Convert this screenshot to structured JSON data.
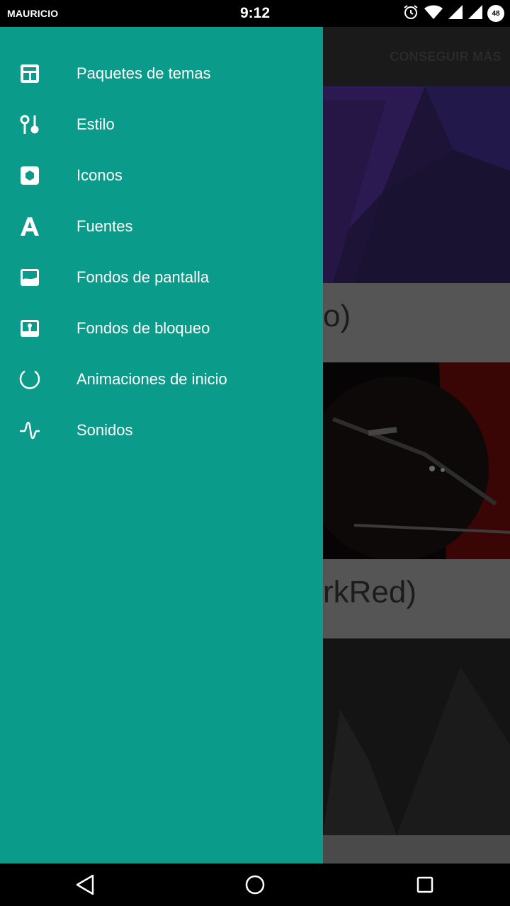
{
  "status_bar": {
    "carrier": "MAURICIO",
    "time": "9:12",
    "battery": "48",
    "icons": [
      "alarm-icon",
      "wifi-icon",
      "signal-icon",
      "signal-icon",
      "battery-icon"
    ]
  },
  "background_app": {
    "toolbar_action": "CONSEGUIR MÁS",
    "cards": [
      {
        "title_fragment": "o)"
      },
      {
        "title_fragment": "rkRed)"
      }
    ]
  },
  "drawer": {
    "accent_color": "#0a9b8a",
    "items": [
      {
        "label": "Paquetes de temas",
        "icon": "theme-pack-icon"
      },
      {
        "label": "Estilo",
        "icon": "style-icon"
      },
      {
        "label": "Iconos",
        "icon": "icons-icon"
      },
      {
        "label": "Fuentes",
        "icon": "font-icon"
      },
      {
        "label": "Fondos de pantalla",
        "icon": "wallpaper-icon"
      },
      {
        "label": "Fondos de bloqueo",
        "icon": "lock-wallpaper-icon"
      },
      {
        "label": "Animaciones de inicio",
        "icon": "boot-animation-icon"
      },
      {
        "label": "Sonidos",
        "icon": "sound-icon"
      }
    ]
  },
  "nav_bar": {
    "icons": [
      "back-icon",
      "home-icon",
      "recents-icon"
    ]
  }
}
